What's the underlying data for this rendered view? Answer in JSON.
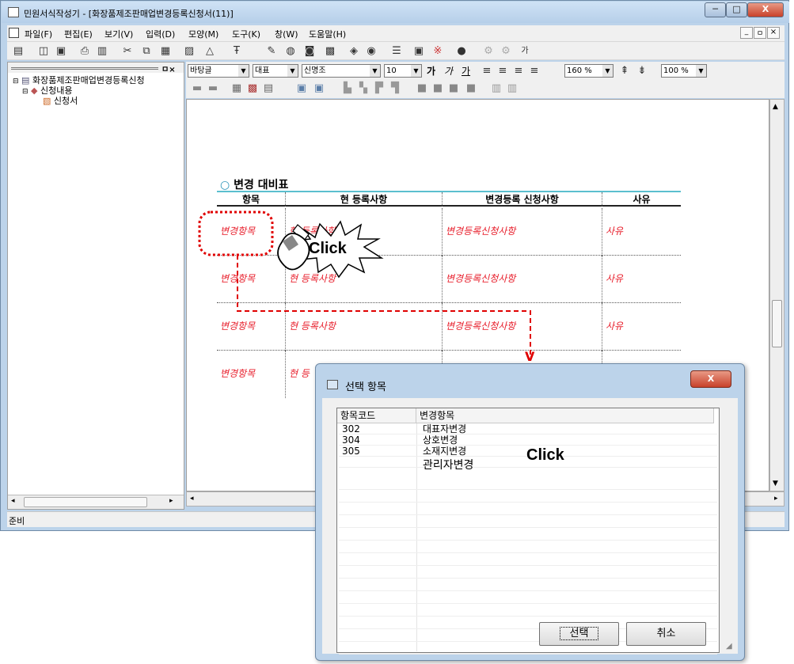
{
  "window": {
    "title": "민원서식작성기 - [화장품제조판매업변경등록신청서(11)]",
    "min": "─",
    "max": "□",
    "close": "X"
  },
  "menu": [
    "파일(F)",
    "편집(E)",
    "보기(V)",
    "입력(D)",
    "모양(M)",
    "도구(K)",
    "창(W)",
    "도움말(H)"
  ],
  "mdi_controls": [
    "_",
    "ㅁ",
    "×"
  ],
  "toolbar_icons": [
    "new-icon",
    "open-icon",
    "save-icon",
    "print-icon",
    "preview-icon",
    "cut-icon",
    "copy-icon",
    "paste-icon",
    "format-icon",
    "shape-icon",
    "pen-icon",
    "image-icon",
    "table-icon",
    "chart-icon",
    "link-icon",
    "bookmark-icon",
    "field-icon",
    "grid-icon",
    "special-char-icon",
    "info-icon"
  ],
  "toolbar_extra_label": "가",
  "tree": {
    "pane_controls": "ㅁ×",
    "root": "화장품제조판매업변경등록신청",
    "child": "신청내용",
    "leaf": "신청서"
  },
  "format": {
    "font_type": "바탕글",
    "style": "대표",
    "font": "신명조",
    "size": "10",
    "bold": "가",
    "italic": "가",
    "underline": "가",
    "zoom1": "160 %",
    "zoom2": "100 %"
  },
  "document": {
    "section_title": "변경 대비표",
    "headers": [
      "항목",
      "현 등록사항",
      "변경등록 신청사항",
      "사유"
    ],
    "rows": [
      [
        "변경항목",
        "현 등록사항",
        "변경등록신청사항",
        "사유"
      ],
      [
        "변경항목",
        "현 등록사항",
        "변경등록신청사항",
        "사유"
      ],
      [
        "변경항목",
        "현 등록사항",
        "변경등록신청사항",
        "사유"
      ],
      [
        "변경항목",
        "현 등",
        "",
        ""
      ]
    ]
  },
  "statusbar": {
    "text": "준비"
  },
  "annotations": {
    "click1": "Click",
    "click2": "Click",
    "arrow": "V"
  },
  "dialog": {
    "title": "선택 항목",
    "close": "X",
    "columns": [
      "항목코드",
      "변경항목"
    ],
    "items": [
      {
        "code": "302",
        "name": "대표자변경"
      },
      {
        "code": "304",
        "name": "상호변경"
      },
      {
        "code": "305",
        "name": "소재지변경"
      },
      {
        "code": "",
        "name": "관리자변경"
      }
    ],
    "select_button": "선택",
    "cancel_button": "취소"
  },
  "colors": {
    "window_frame": "#bcd3ea",
    "accent_red": "#e8212e",
    "table_header_line": "#5bbfcf",
    "annotation_red": "#e00000"
  }
}
